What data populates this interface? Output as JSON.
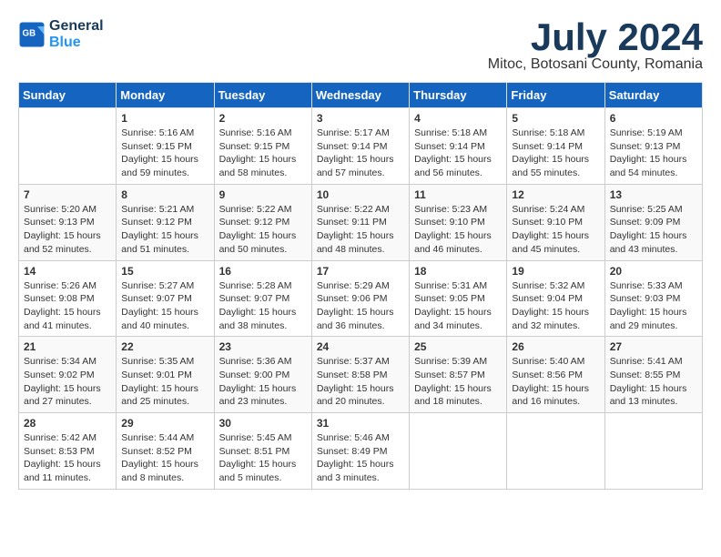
{
  "header": {
    "logo_line1": "General",
    "logo_line2": "Blue",
    "month": "July 2024",
    "location": "Mitoc, Botosani County, Romania"
  },
  "weekdays": [
    "Sunday",
    "Monday",
    "Tuesday",
    "Wednesday",
    "Thursday",
    "Friday",
    "Saturday"
  ],
  "weeks": [
    [
      {
        "day": "",
        "info": ""
      },
      {
        "day": "1",
        "info": "Sunrise: 5:16 AM\nSunset: 9:15 PM\nDaylight: 15 hours\nand 59 minutes."
      },
      {
        "day": "2",
        "info": "Sunrise: 5:16 AM\nSunset: 9:15 PM\nDaylight: 15 hours\nand 58 minutes."
      },
      {
        "day": "3",
        "info": "Sunrise: 5:17 AM\nSunset: 9:14 PM\nDaylight: 15 hours\nand 57 minutes."
      },
      {
        "day": "4",
        "info": "Sunrise: 5:18 AM\nSunset: 9:14 PM\nDaylight: 15 hours\nand 56 minutes."
      },
      {
        "day": "5",
        "info": "Sunrise: 5:18 AM\nSunset: 9:14 PM\nDaylight: 15 hours\nand 55 minutes."
      },
      {
        "day": "6",
        "info": "Sunrise: 5:19 AM\nSunset: 9:13 PM\nDaylight: 15 hours\nand 54 minutes."
      }
    ],
    [
      {
        "day": "7",
        "info": "Sunrise: 5:20 AM\nSunset: 9:13 PM\nDaylight: 15 hours\nand 52 minutes."
      },
      {
        "day": "8",
        "info": "Sunrise: 5:21 AM\nSunset: 9:12 PM\nDaylight: 15 hours\nand 51 minutes."
      },
      {
        "day": "9",
        "info": "Sunrise: 5:22 AM\nSunset: 9:12 PM\nDaylight: 15 hours\nand 50 minutes."
      },
      {
        "day": "10",
        "info": "Sunrise: 5:22 AM\nSunset: 9:11 PM\nDaylight: 15 hours\nand 48 minutes."
      },
      {
        "day": "11",
        "info": "Sunrise: 5:23 AM\nSunset: 9:10 PM\nDaylight: 15 hours\nand 46 minutes."
      },
      {
        "day": "12",
        "info": "Sunrise: 5:24 AM\nSunset: 9:10 PM\nDaylight: 15 hours\nand 45 minutes."
      },
      {
        "day": "13",
        "info": "Sunrise: 5:25 AM\nSunset: 9:09 PM\nDaylight: 15 hours\nand 43 minutes."
      }
    ],
    [
      {
        "day": "14",
        "info": "Sunrise: 5:26 AM\nSunset: 9:08 PM\nDaylight: 15 hours\nand 41 minutes."
      },
      {
        "day": "15",
        "info": "Sunrise: 5:27 AM\nSunset: 9:07 PM\nDaylight: 15 hours\nand 40 minutes."
      },
      {
        "day": "16",
        "info": "Sunrise: 5:28 AM\nSunset: 9:07 PM\nDaylight: 15 hours\nand 38 minutes."
      },
      {
        "day": "17",
        "info": "Sunrise: 5:29 AM\nSunset: 9:06 PM\nDaylight: 15 hours\nand 36 minutes."
      },
      {
        "day": "18",
        "info": "Sunrise: 5:31 AM\nSunset: 9:05 PM\nDaylight: 15 hours\nand 34 minutes."
      },
      {
        "day": "19",
        "info": "Sunrise: 5:32 AM\nSunset: 9:04 PM\nDaylight: 15 hours\nand 32 minutes."
      },
      {
        "day": "20",
        "info": "Sunrise: 5:33 AM\nSunset: 9:03 PM\nDaylight: 15 hours\nand 29 minutes."
      }
    ],
    [
      {
        "day": "21",
        "info": "Sunrise: 5:34 AM\nSunset: 9:02 PM\nDaylight: 15 hours\nand 27 minutes."
      },
      {
        "day": "22",
        "info": "Sunrise: 5:35 AM\nSunset: 9:01 PM\nDaylight: 15 hours\nand 25 minutes."
      },
      {
        "day": "23",
        "info": "Sunrise: 5:36 AM\nSunset: 9:00 PM\nDaylight: 15 hours\nand 23 minutes."
      },
      {
        "day": "24",
        "info": "Sunrise: 5:37 AM\nSunset: 8:58 PM\nDaylight: 15 hours\nand 20 minutes."
      },
      {
        "day": "25",
        "info": "Sunrise: 5:39 AM\nSunset: 8:57 PM\nDaylight: 15 hours\nand 18 minutes."
      },
      {
        "day": "26",
        "info": "Sunrise: 5:40 AM\nSunset: 8:56 PM\nDaylight: 15 hours\nand 16 minutes."
      },
      {
        "day": "27",
        "info": "Sunrise: 5:41 AM\nSunset: 8:55 PM\nDaylight: 15 hours\nand 13 minutes."
      }
    ],
    [
      {
        "day": "28",
        "info": "Sunrise: 5:42 AM\nSunset: 8:53 PM\nDaylight: 15 hours\nand 11 minutes."
      },
      {
        "day": "29",
        "info": "Sunrise: 5:44 AM\nSunset: 8:52 PM\nDaylight: 15 hours\nand 8 minutes."
      },
      {
        "day": "30",
        "info": "Sunrise: 5:45 AM\nSunset: 8:51 PM\nDaylight: 15 hours\nand 5 minutes."
      },
      {
        "day": "31",
        "info": "Sunrise: 5:46 AM\nSunset: 8:49 PM\nDaylight: 15 hours\nand 3 minutes."
      },
      {
        "day": "",
        "info": ""
      },
      {
        "day": "",
        "info": ""
      },
      {
        "day": "",
        "info": ""
      }
    ]
  ]
}
